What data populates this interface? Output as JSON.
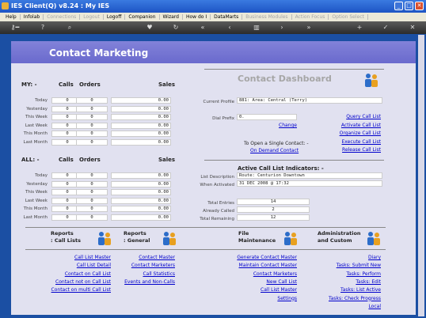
{
  "window": {
    "title": "IES Client(Q) v8.24 : My IES"
  },
  "menu": [
    "Help",
    "Infolab",
    "Connections",
    "Logout",
    "Logoff",
    "Companion",
    "Wizard",
    "How do I",
    "DataMarts",
    "Business Modules",
    "Action Focus",
    "Option Select"
  ],
  "menu_disabled": [
    false,
    false,
    true,
    true,
    false,
    false,
    false,
    false,
    false,
    true,
    true,
    true
  ],
  "page_title": "Contact Marketing",
  "my": {
    "label": "MY: -",
    "col_calls": "Calls",
    "col_orders": "Orders",
    "col_sales": "Sales",
    "rows": [
      {
        "label": "Today",
        "calls": "0",
        "orders": "0",
        "sales": "0.00"
      },
      {
        "label": "Yesterday",
        "calls": "0",
        "orders": "0",
        "sales": "0.00"
      },
      {
        "label": "This Week",
        "calls": "0",
        "orders": "0",
        "sales": "0.00"
      },
      {
        "label": "Last Week",
        "calls": "0",
        "orders": "0",
        "sales": "0.00"
      },
      {
        "label": "This Month",
        "calls": "0",
        "orders": "0",
        "sales": "0.00"
      },
      {
        "label": "Last Month",
        "calls": "0",
        "orders": "0",
        "sales": "0.00"
      }
    ]
  },
  "all": {
    "label": "ALL: -",
    "col_calls": "Calls",
    "col_orders": "Orders",
    "col_sales": "Sales",
    "rows": [
      {
        "label": "Today",
        "calls": "0",
        "orders": "0",
        "sales": "0.00"
      },
      {
        "label": "Yesterday",
        "calls": "0",
        "orders": "0",
        "sales": "0.00"
      },
      {
        "label": "This Week",
        "calls": "0",
        "orders": "0",
        "sales": "0.00"
      },
      {
        "label": "Last Week",
        "calls": "0",
        "orders": "0",
        "sales": "0.00"
      },
      {
        "label": "This Month",
        "calls": "0",
        "orders": "0",
        "sales": "0.00"
      },
      {
        "label": "Last Month",
        "calls": "0",
        "orders": "0",
        "sales": "0.00"
      }
    ]
  },
  "dashboard": {
    "title": "Contact Dashboard",
    "current_profile_label": "Current Profile",
    "current_profile_value": "881: Area: Central (Terry)",
    "dial_prefix_label": "Dial Prefix",
    "dial_prefix_value": "0.",
    "change_link": "Change",
    "open_single_label": "To Open a Single Contact: -",
    "on_demand_link": "On Demand Contact",
    "links": [
      "Query Call List",
      "Activate Call List",
      "Organize Call List",
      "Execute Call List",
      "Release Call List"
    ],
    "indicators_title": "Active Call List Indicators: -",
    "list_desc_label": "List Description",
    "list_desc_value": "Route: Centurion Downtown",
    "when_activated_label": "When Activated",
    "when_activated_value": "31 DEC 2008 @ 17:32",
    "total_entries_label": "Total Entries",
    "total_entries_value": "14",
    "already_called_label": "Already Called",
    "already_called_value": "2",
    "total_remaining_label": "Total Remaining",
    "total_remaining_value": "12"
  },
  "sections": [
    {
      "title1": "Reports",
      "title2": ": Call Lists",
      "links": [
        "Call List Master",
        "Call List Detail",
        "Contact on Call List",
        "Contact not on Call List",
        "Contact on multi Call List"
      ]
    },
    {
      "title1": "Reports",
      "title2": ": General",
      "links": [
        "Contact Master",
        "Contact Marketers",
        "Call Statistics",
        "Events and Non-Calls"
      ]
    },
    {
      "title1": "File",
      "title2": "Maintenance",
      "links": [
        "Generate Contact Master",
        "Maintain Contact Master",
        "Contact Marketers",
        "New Call List",
        "Call List Master",
        "Settings"
      ]
    },
    {
      "title1": "Administration",
      "title2": "and Custom",
      "links": [
        "Diary",
        "Tasks: Submit New",
        "Tasks: Perform",
        "Tasks: Edit",
        "Tasks: List Active",
        "Tasks: Check Progress",
        "Local"
      ]
    }
  ]
}
